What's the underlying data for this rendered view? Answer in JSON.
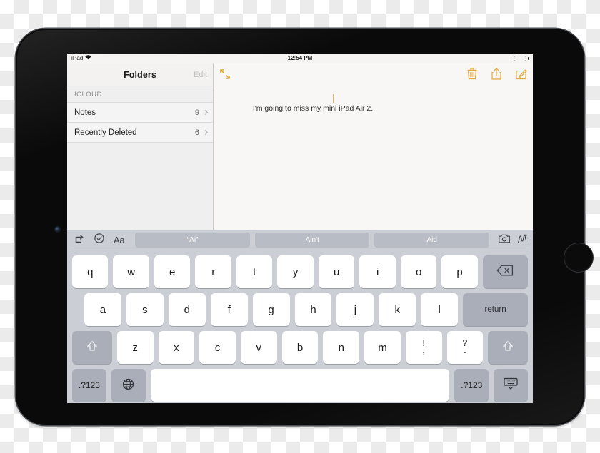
{
  "device": {
    "name": "ipad-air-2",
    "bezel_color": "#0a0a0a"
  },
  "status_bar": {
    "device_label": "iPad",
    "wifi_icon": "wifi-icon",
    "time": "12:54 PM",
    "battery_icon": "battery-full-icon",
    "battery_level_pct": 100
  },
  "sidebar": {
    "title": "Folders",
    "edit_label": "Edit",
    "section_header": "ICLOUD",
    "items": [
      {
        "label": "Notes",
        "count": "9",
        "chevron_icon": "chevron-right-icon"
      },
      {
        "label": "Recently Deleted",
        "count": "6",
        "chevron_icon": "chevron-right-icon"
      }
    ]
  },
  "note_pane": {
    "expand_icon": "expand-diagonal-icon",
    "accent_color": "#e0a93c",
    "actions": [
      {
        "name": "delete-note-button",
        "icon": "trash-icon"
      },
      {
        "name": "share-note-button",
        "icon": "share-up-icon"
      },
      {
        "name": "compose-note-button",
        "icon": "compose-pencil-icon"
      }
    ],
    "note_text": "I'm going to miss my mini iPad Air 2.",
    "caret_after_chars": 33
  },
  "keyboard": {
    "suggestion_bar": {
      "left_icons": [
        {
          "name": "undo-icon",
          "icon": "undo-arrow-icon"
        },
        {
          "name": "checkmark-circle-icon",
          "icon": "checkmark-circle-icon"
        },
        {
          "name": "text-format-icon",
          "label": "Aa"
        }
      ],
      "predictions": [
        "“Ai”",
        "Ain't",
        "Aid"
      ],
      "right_icons": [
        {
          "name": "camera-icon",
          "icon": "camera-icon"
        },
        {
          "name": "markup-pen-icon",
          "icon": "markup-pen-icon"
        }
      ]
    },
    "row1": [
      "q",
      "w",
      "e",
      "r",
      "t",
      "y",
      "u",
      "i",
      "o",
      "p"
    ],
    "row1_action": {
      "label": "",
      "icon": "backspace-delete-icon",
      "name": "backspace-key"
    },
    "row2": [
      "a",
      "s",
      "d",
      "f",
      "g",
      "h",
      "j",
      "k",
      "l"
    ],
    "row2_action": {
      "label": "return",
      "name": "return-key"
    },
    "row3_shift_left": {
      "icon": "shift-up-arrow-icon",
      "name": "shift-key-left"
    },
    "row3": [
      "z",
      "x",
      "c",
      "v",
      "b",
      "n",
      "m"
    ],
    "row3_dual": [
      {
        "top": "!",
        "bot": ",",
        "name": "exclamation-comma-key"
      },
      {
        "top": "?",
        "bot": ".",
        "name": "question-period-key"
      }
    ],
    "row3_shift_right": {
      "icon": "shift-up-arrow-icon",
      "name": "shift-key-right"
    },
    "row4": {
      "numbers_left": ".?123",
      "globe_icon": "globe-language-icon",
      "space_label": "",
      "numbers_right": ".?123",
      "dismiss_icon": "keyboard-dismiss-icon"
    }
  },
  "colors": {
    "accent": "#e0a93c",
    "keyboard_bg": "#cbced5",
    "key_white": "#ffffff",
    "key_dark": "#a9aeb8",
    "sidebar_bg": "#efefef"
  }
}
